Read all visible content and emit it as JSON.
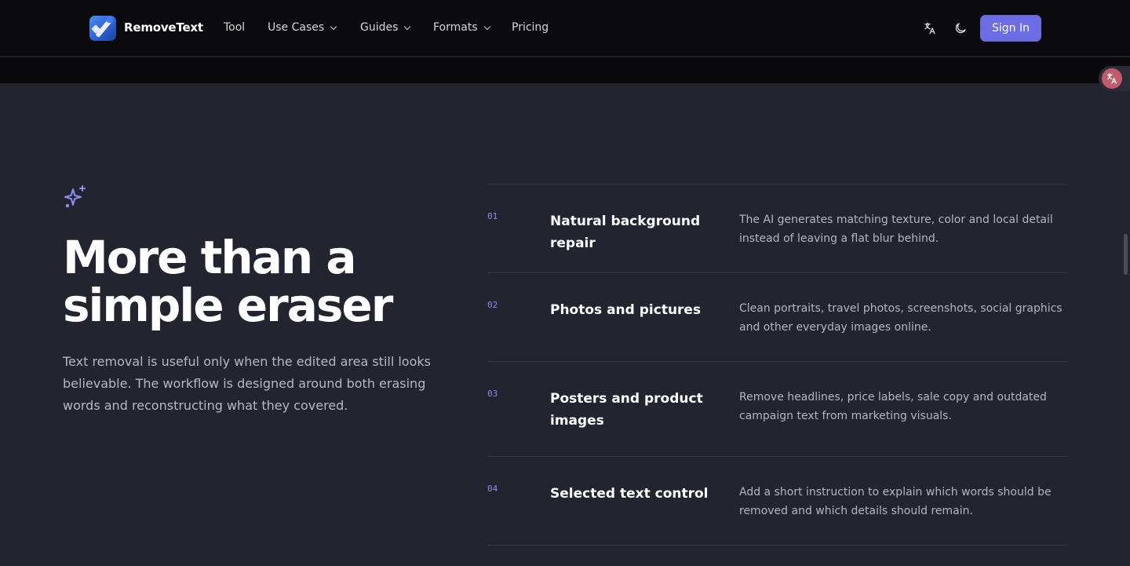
{
  "header": {
    "brand": "RemoveText",
    "nav": [
      {
        "label": "Tool",
        "has_dropdown": false
      },
      {
        "label": "Use Cases",
        "has_dropdown": true
      },
      {
        "label": "Guides",
        "has_dropdown": true
      },
      {
        "label": "Formats",
        "has_dropdown": true
      },
      {
        "label": "Pricing",
        "has_dropdown": false
      }
    ],
    "icons": [
      "translate-icon",
      "moon-icon"
    ],
    "signin_label": "Sign In"
  },
  "floating": {
    "icon": "translate-badge-icon"
  },
  "hero": {
    "title": "More than a simple eraser",
    "description": "Text removal is useful only when the edited area still looks believable. The workflow is designed around both erasing words and reconstructing what they covered."
  },
  "features": [
    {
      "num": "01",
      "title": "Natural background repair",
      "desc": "The AI generates matching texture, color and local detail instead of leaving a flat blur behind."
    },
    {
      "num": "02",
      "title": "Photos and pictures",
      "desc": "Clean portraits, travel photos, screenshots, social graphics and other everyday images online."
    },
    {
      "num": "03",
      "title": "Posters and product images",
      "desc": "Remove headlines, price labels, sale copy and outdated campaign text from marketing visuals."
    },
    {
      "num": "04",
      "title": "Selected text control",
      "desc": "Add a short instruction to explain which words should be removed and which details should remain."
    }
  ],
  "colors": {
    "accent": "#6c6ce4",
    "background": "#22242f",
    "header": "#0b0b0f"
  }
}
